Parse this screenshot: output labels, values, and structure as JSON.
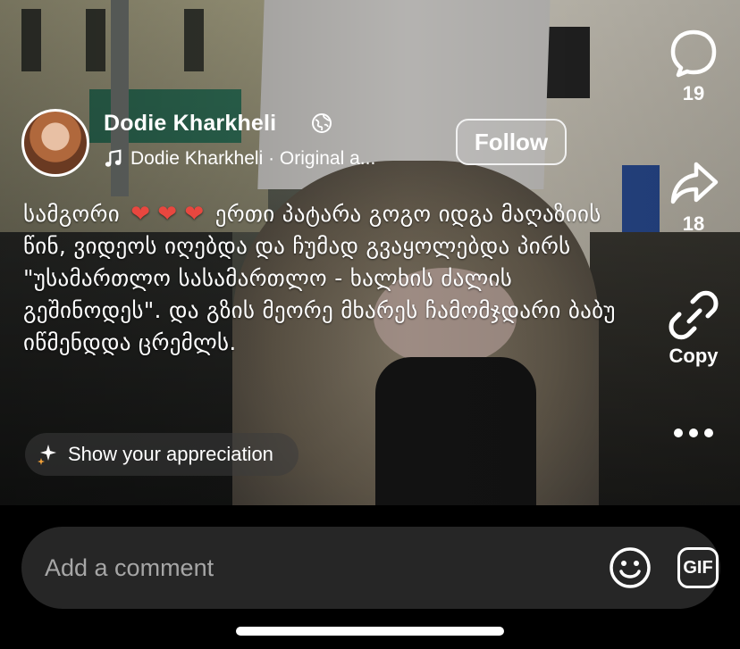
{
  "post": {
    "author_name": "Dodie Kharkheli",
    "audio_label": "Dodie Kharkheli · Original a...",
    "follow_label": "Follow",
    "caption_lead": "სამგორი",
    "caption_body": "ერთი პატარა გოგო იდგა მაღაზიის წინ, ვიდეოს იღებდა და ჩუმად გვაყოლებდა პირს \"უსამართლო სასამართლო - ხალხის ძალის გეშინოდეს\". და გზის მეორე მხარეს ჩამომჯდარი ბაბუ იწმენდდა ცრემლს.",
    "heart_glyph": "❤",
    "appreciation_label": "Show your appreciation"
  },
  "rail": {
    "comments_count": "19",
    "shares_count": "18",
    "copy_label": "Copy"
  },
  "comment_bar": {
    "placeholder": "Add a comment",
    "gif_label": "GIF"
  },
  "icons": {
    "globe": "globe-icon",
    "music": "music-note-icon",
    "sparkle": "sparkle-icon",
    "comment": "comment-bubble-icon",
    "share": "share-arrow-icon",
    "link": "link-icon",
    "more": "more-dots-icon",
    "emoji": "emoji-icon",
    "gif": "gif-icon"
  },
  "colors": {
    "heart": "#e8473f",
    "comment_box": "#262626",
    "placeholder": "#a6a6a6"
  }
}
